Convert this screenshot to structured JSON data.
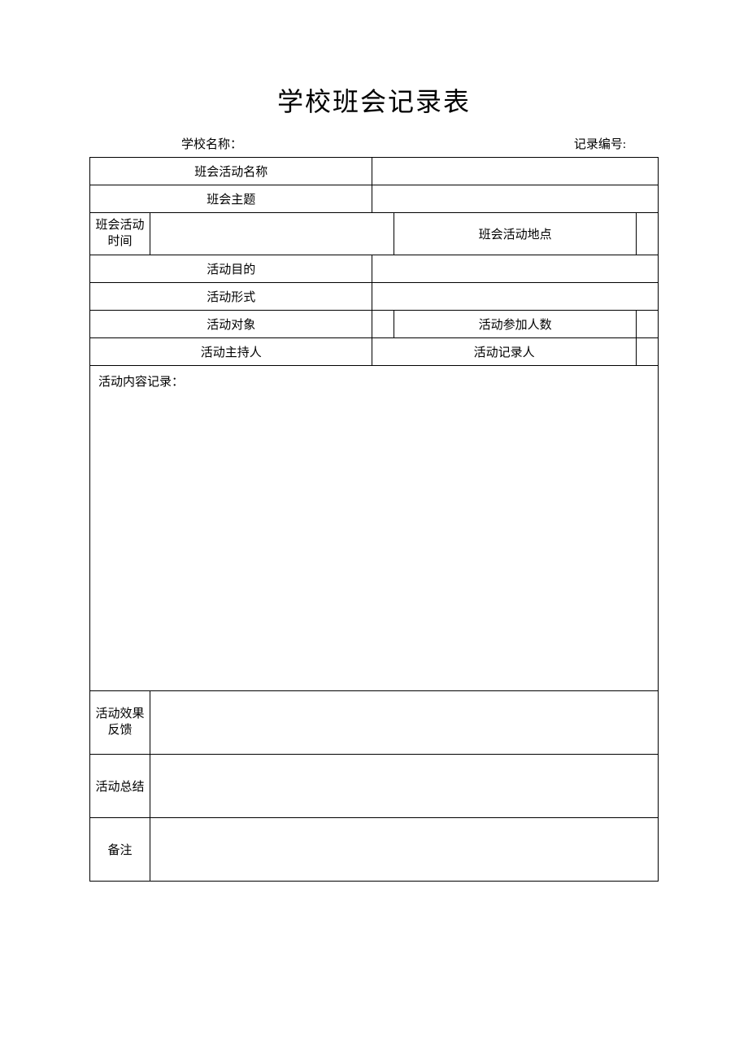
{
  "title": "学校班会记录表",
  "header": {
    "school_label": "学校名称：",
    "record_label": "记录编号:"
  },
  "rows": {
    "activity_name": "班会活动名称",
    "theme": "班会主题",
    "time_label_1": "班会活动",
    "time_label_2": "时间",
    "location": "班会活动地点",
    "purpose": "活动目的",
    "form": "活动形式",
    "target": "活动对象",
    "participants": "活动参加人数",
    "host": "活动主持人",
    "recorder": "活动记录人",
    "content": "活动内容记录：",
    "feedback_1": "活动效果",
    "feedback_2": "反馈",
    "summary": "活动总结",
    "notes": "备注"
  }
}
